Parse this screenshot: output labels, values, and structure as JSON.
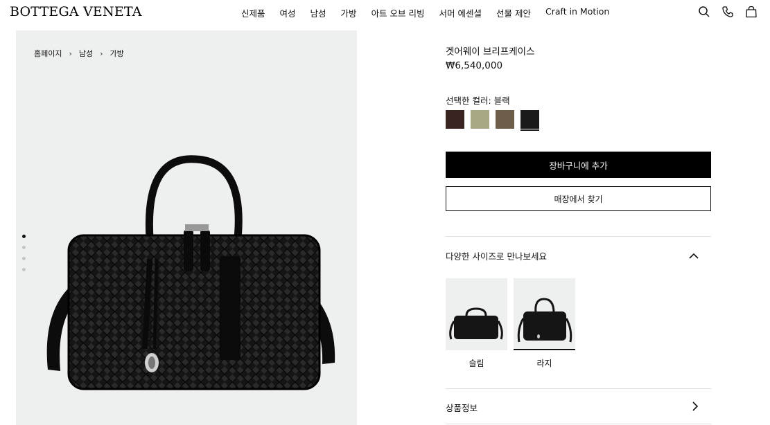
{
  "header": {
    "logo": "BOTTEGA VENETA",
    "nav": [
      "신제품",
      "여성",
      "남성",
      "가방",
      "아트 오브 리빙",
      "서머 에센셜",
      "선물 제안",
      "Craft in Motion"
    ],
    "icons": [
      "search-icon",
      "phone-icon",
      "bag-icon"
    ]
  },
  "breadcrumb": [
    "홈페이지",
    "남성",
    "가방"
  ],
  "gallery": {
    "slide_count": 4,
    "active_index": 0
  },
  "product": {
    "title": "겟어웨이 브리프케이스",
    "price": "₩6,540,000",
    "color_label": "선택한 컬러: 블랙",
    "swatches": [
      {
        "name": "dark-brown",
        "color": "#3a2420"
      },
      {
        "name": "sage",
        "color": "#a8a884"
      },
      {
        "name": "taupe",
        "color": "#6e5d48"
      },
      {
        "name": "black",
        "color": "#1a1a1a"
      }
    ],
    "selected_swatch": 3
  },
  "actions": {
    "add_to_cart": "장바구니에 추가",
    "find_store": "매장에서 찾기"
  },
  "sizes": {
    "heading": "다양한 사이즈로 만나보세요",
    "items": [
      {
        "label": "슬림"
      },
      {
        "label": "라지"
      }
    ],
    "selected": 1
  },
  "details": {
    "heading": "상품정보"
  }
}
